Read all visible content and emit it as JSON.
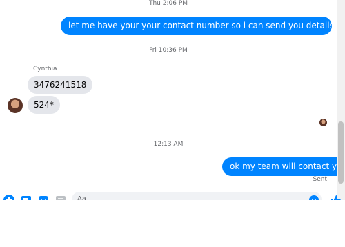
{
  "messages": {
    "timestamp_1": "Thu 2:06 PM",
    "out_1": "let me have your your contact number so i can send you details or call you",
    "timestamp_2": "Fri 10:36 PM",
    "sender_name": "Cynthia",
    "in_1": "3476241518",
    "in_2": "524*",
    "timestamp_3": "12:13 AM",
    "out_2": "ok my team will contact you",
    "status": "Sent"
  },
  "composer": {
    "placeholder": "Aa",
    "icons": [
      "plus-icon",
      "image-icon",
      "sticker-icon",
      "gif-icon",
      "emoji-icon",
      "thumbs-up-icon"
    ]
  },
  "colors": {
    "outgoing_bubble": "#0084ff",
    "incoming_bubble": "#e4e6eb",
    "accent": "#0084ff"
  }
}
